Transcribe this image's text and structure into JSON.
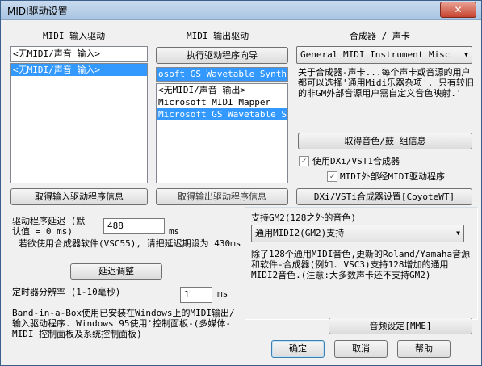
{
  "window": {
    "title": "MIDI驱动设置",
    "close": "✕"
  },
  "input_section": {
    "header": "MIDI 输入驱动",
    "selected_display": "<无MIDI/声音 输入>",
    "list": [
      "<无MIDI/声音 输入>"
    ],
    "get_info_button": "取得输入驱动程序信息"
  },
  "output_section": {
    "header": "MIDI 输出驱动",
    "wizard_button": "执行驱动程序向导",
    "selected_display": "osoft GS Wavetable Synth",
    "list": [
      "<无MIDI/声音 输出>",
      "Microsoft MIDI Mapper",
      "Microsoft GS Wavetable S"
    ],
    "get_info_button": "取得输出驱动程序信息"
  },
  "synth_section": {
    "header": "合成器 / 声卡",
    "select_value": "General MIDI Instrument Misc",
    "description": "关于合成器-声卡...每个声卡或音源的用户都可以选择'通用Midi乐器杂项'. 只有较旧的非GM外部音源用户需自定义音色映射.'",
    "patch_button": "取得音色/鼓 组信息",
    "dxi_checkbox": "使用DXi/VST1合成器",
    "external_checkbox": "MIDI外部经MIDI驱动程序",
    "dxi_settings_button": "DXi/VSTi合成器设置[CoyoteWT]"
  },
  "latency": {
    "label_line1": "驱动程序延迟 (默",
    "label_line2": "认值 = 0 ms)",
    "value": "488",
    "unit": "ms",
    "note": "若欲使用合成器软件(VSC55), 请把延迟期设为 430ms",
    "adjust_button": "延迟调整"
  },
  "timer": {
    "label": "定时器分辨率 (1-10毫秒)",
    "value": "1",
    "unit": "ms"
  },
  "footer_note": "Band-in-a-Box使用已安装在Windows上的MIDI输出/输入驱动程序. Windows 95使用'控制面板-(多媒体-MIDI 控制面板及系统控制面板)",
  "gm2": {
    "label": "支持GM2(128之外的音色)",
    "select_value": "通用MIDI2(GM2)支持",
    "description": "除了128个通用MIDI音色,更新的Roland/Yamaha音源和软件-合成器(例如. VSC3)支持128增加的通用MIDI2音色.(注意:大多数声卡还不支持GM2)"
  },
  "audio_button": "音频设定[MME]",
  "buttons": {
    "ok": "确定",
    "cancel": "取消",
    "help": "帮助"
  }
}
